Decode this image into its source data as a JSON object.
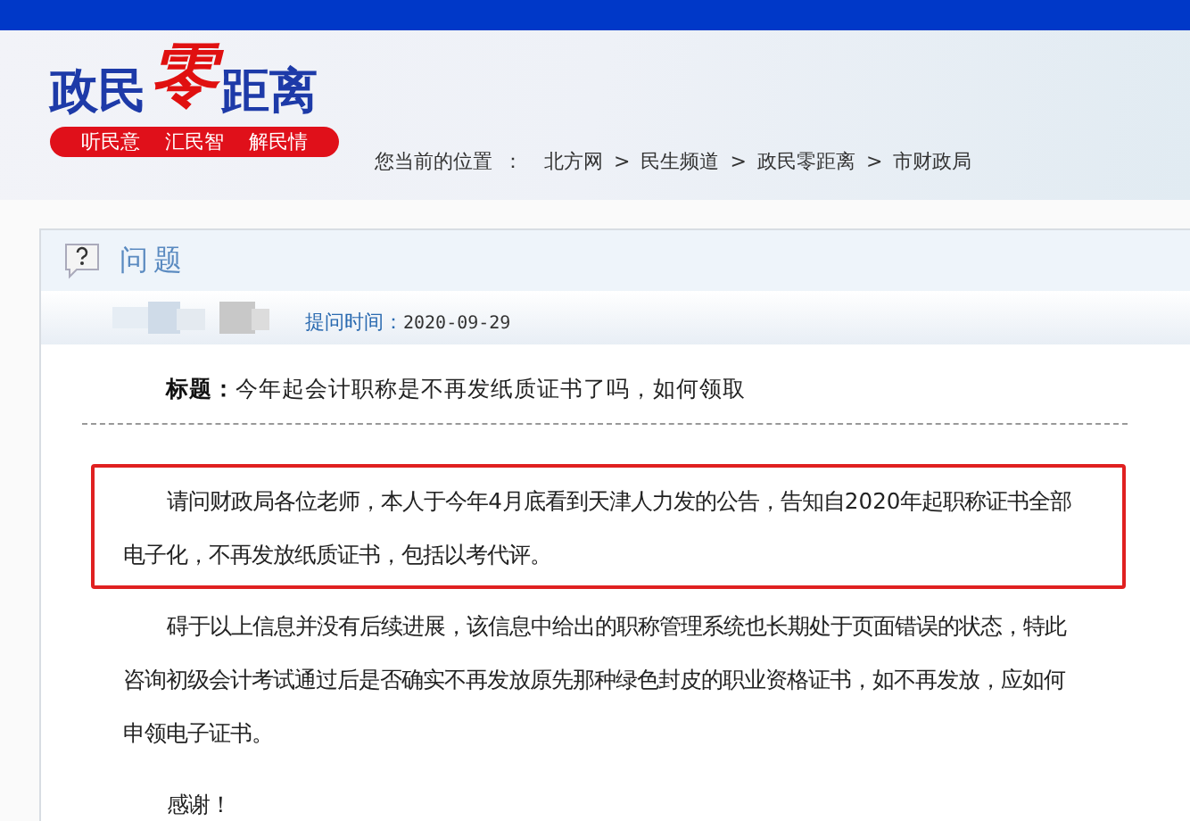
{
  "header": {
    "logo": {
      "part_1": "政民",
      "part_2": "零",
      "part_3": "距离"
    },
    "slogans": [
      "听民意",
      "汇民智",
      "解民情"
    ],
    "breadcrumb": {
      "label": "您当前的位置",
      "separator": "：",
      "items": [
        "北方网",
        "民生频道",
        "政民零距离",
        "市财政局"
      ],
      "divider": ">"
    }
  },
  "question": {
    "heading": "问题",
    "time_label": "提问时间：",
    "time": "2020-09-29",
    "title_label": "标题：",
    "title": "今年起会计职称是不再发纸质证书了吗，如何领取",
    "paragraphs": [
      {
        "text": "请问财政局各位老师，本人于今年4月底看到天津人力发的公告，告知自2020年起职称证书全部电子化，不再发放纸质证书，包括以考代评。",
        "highlighted": true
      },
      {
        "text": "碍于以上信息并没有后续进展，该信息中给出的职称管理系统也长期处于页面错误的状态，特此咨询初级会计考试通过后是否确实不再发放原先那种绿色封皮的职业资格证书，如不再发放，应如何申领电子证书。",
        "highlighted": false
      },
      {
        "text": "感谢！",
        "highlighted": false
      }
    ]
  }
}
